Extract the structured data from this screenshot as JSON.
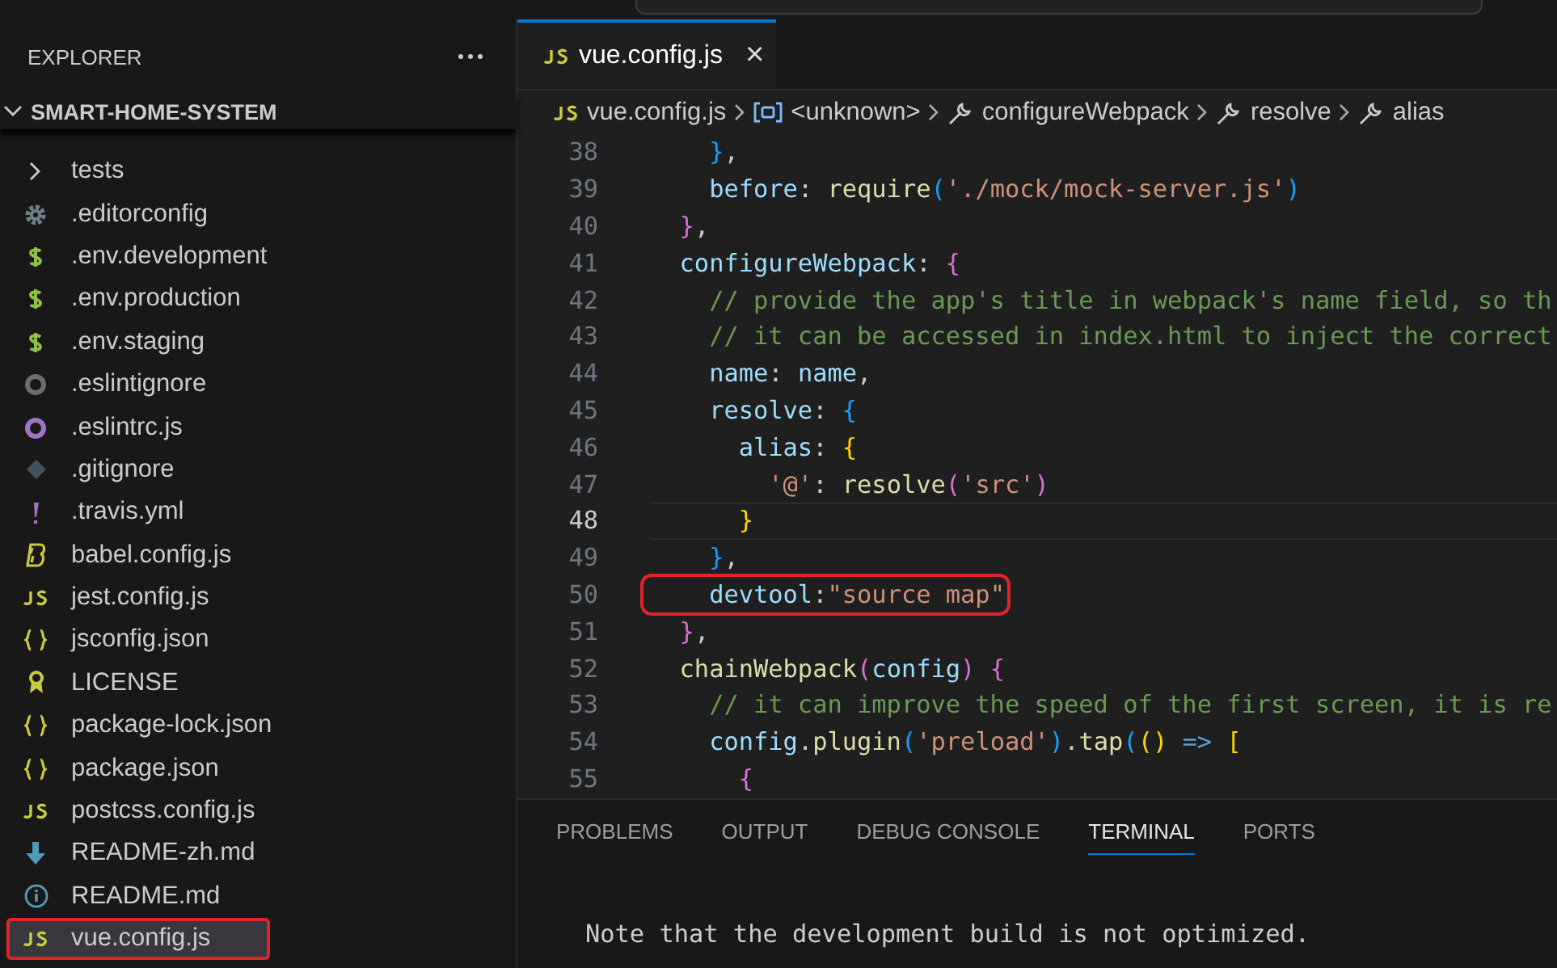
{
  "sidebar": {
    "title": "EXPLORER",
    "project": "SMART-HOME-SYSTEM",
    "items": [
      {
        "label": "tests",
        "kind": "folder",
        "selected": false,
        "highlighted": false
      },
      {
        "label": ".editorconfig",
        "kind": "gear",
        "selected": false,
        "highlighted": false
      },
      {
        "label": ".env.development",
        "kind": "dollar",
        "selected": false,
        "highlighted": false
      },
      {
        "label": ".env.production",
        "kind": "dollar",
        "selected": false,
        "highlighted": false
      },
      {
        "label": ".env.staging",
        "kind": "dollar",
        "selected": false,
        "highlighted": false
      },
      {
        "label": ".eslintignore",
        "kind": "ring-grey",
        "selected": false,
        "highlighted": false
      },
      {
        "label": ".eslintrc.js",
        "kind": "ring-purple",
        "selected": false,
        "highlighted": false
      },
      {
        "label": ".gitignore",
        "kind": "diamond",
        "selected": false,
        "highlighted": false
      },
      {
        "label": ".travis.yml",
        "kind": "exclaim",
        "selected": false,
        "highlighted": false
      },
      {
        "label": "babel.config.js",
        "kind": "b",
        "selected": false,
        "highlighted": false
      },
      {
        "label": "jest.config.js",
        "kind": "js",
        "selected": false,
        "highlighted": false
      },
      {
        "label": "jsconfig.json",
        "kind": "braces",
        "selected": false,
        "highlighted": false
      },
      {
        "label": "LICENSE",
        "kind": "license",
        "selected": false,
        "highlighted": false
      },
      {
        "label": "package-lock.json",
        "kind": "braces",
        "selected": false,
        "highlighted": false
      },
      {
        "label": "package.json",
        "kind": "braces",
        "selected": false,
        "highlighted": false
      },
      {
        "label": "postcss.config.js",
        "kind": "js",
        "selected": false,
        "highlighted": false
      },
      {
        "label": "README-zh.md",
        "kind": "down",
        "selected": false,
        "highlighted": false
      },
      {
        "label": "README.md",
        "kind": "info",
        "selected": false,
        "highlighted": false
      },
      {
        "label": "vue.config.js",
        "kind": "js",
        "selected": true,
        "highlighted": true
      }
    ]
  },
  "tab": {
    "label": "vue.config.js",
    "close": "×"
  },
  "breadcrumbs": [
    {
      "label": "vue.config.js",
      "kind": "js"
    },
    {
      "label": "<unknown>",
      "kind": "variable"
    },
    {
      "label": "configureWebpack",
      "kind": "wrench"
    },
    {
      "label": "resolve",
      "kind": "wrench"
    },
    {
      "label": "alias",
      "kind": "wrench"
    }
  ],
  "code": [
    {
      "number": "38",
      "current": false,
      "highlighted": false,
      "tokens": [
        {
          "text": "    }",
          "kind": "b3"
        },
        {
          "text": ",",
          "kind": "plain"
        }
      ]
    },
    {
      "number": "39",
      "current": false,
      "highlighted": false,
      "tokens": [
        {
          "text": "    before",
          "kind": "prop"
        },
        {
          "text": ": ",
          "kind": "plain"
        },
        {
          "text": "require",
          "kind": "func"
        },
        {
          "text": "(",
          "kind": "b3"
        },
        {
          "text": "'./mock/mock-server.js'",
          "kind": "str"
        },
        {
          "text": ")",
          "kind": "b3"
        }
      ]
    },
    {
      "number": "40",
      "current": false,
      "highlighted": false,
      "tokens": [
        {
          "text": "  }",
          "kind": "b2"
        },
        {
          "text": ",",
          "kind": "plain"
        }
      ]
    },
    {
      "number": "41",
      "current": false,
      "highlighted": false,
      "tokens": [
        {
          "text": "  configureWebpack",
          "kind": "prop"
        },
        {
          "text": ": ",
          "kind": "plain"
        },
        {
          "text": "{",
          "kind": "b2"
        }
      ]
    },
    {
      "number": "42",
      "current": false,
      "highlighted": false,
      "tokens": [
        {
          "text": "    // provide the app's title in webpack's name field, so th",
          "kind": "comment"
        }
      ]
    },
    {
      "number": "43",
      "current": false,
      "highlighted": false,
      "tokens": [
        {
          "text": "    // it can be accessed in index.html to inject the correct",
          "kind": "comment"
        }
      ]
    },
    {
      "number": "44",
      "current": false,
      "highlighted": false,
      "tokens": [
        {
          "text": "    name",
          "kind": "prop"
        },
        {
          "text": ": ",
          "kind": "plain"
        },
        {
          "text": "name",
          "kind": "prop"
        },
        {
          "text": ",",
          "kind": "plain"
        }
      ]
    },
    {
      "number": "45",
      "current": false,
      "highlighted": false,
      "tokens": [
        {
          "text": "    resolve",
          "kind": "prop"
        },
        {
          "text": ": ",
          "kind": "plain"
        },
        {
          "text": "{",
          "kind": "b3"
        }
      ]
    },
    {
      "number": "46",
      "current": false,
      "highlighted": false,
      "tokens": [
        {
          "text": "      alias",
          "kind": "prop"
        },
        {
          "text": ": ",
          "kind": "plain"
        },
        {
          "text": "{",
          "kind": "b1"
        }
      ]
    },
    {
      "number": "47",
      "current": false,
      "highlighted": false,
      "tokens": [
        {
          "text": "        '@'",
          "kind": "str"
        },
        {
          "text": ": ",
          "kind": "plain"
        },
        {
          "text": "resolve",
          "kind": "func"
        },
        {
          "text": "(",
          "kind": "b2"
        },
        {
          "text": "'src'",
          "kind": "str"
        },
        {
          "text": ")",
          "kind": "b2"
        }
      ]
    },
    {
      "number": "48",
      "current": true,
      "highlighted": false,
      "tokens": [
        {
          "text": "      }",
          "kind": "b1"
        }
      ]
    },
    {
      "number": "49",
      "current": false,
      "highlighted": false,
      "tokens": [
        {
          "text": "    }",
          "kind": "b3"
        },
        {
          "text": ",",
          "kind": "plain"
        }
      ]
    },
    {
      "number": "50",
      "current": false,
      "highlighted": true,
      "tokens": [
        {
          "text": "    devtool",
          "kind": "prop"
        },
        {
          "text": ":",
          "kind": "plain"
        },
        {
          "text": "\"source map\"",
          "kind": "str"
        }
      ]
    },
    {
      "number": "51",
      "current": false,
      "highlighted": false,
      "tokens": [
        {
          "text": "  }",
          "kind": "b2"
        },
        {
          "text": ",",
          "kind": "plain"
        }
      ]
    },
    {
      "number": "52",
      "current": false,
      "highlighted": false,
      "tokens": [
        {
          "text": "  chainWebpack",
          "kind": "func"
        },
        {
          "text": "(",
          "kind": "b2"
        },
        {
          "text": "config",
          "kind": "prop"
        },
        {
          "text": ")",
          "kind": "b2"
        },
        {
          "text": " {",
          "kind": "b2"
        }
      ]
    },
    {
      "number": "53",
      "current": false,
      "highlighted": false,
      "tokens": [
        {
          "text": "    // it can improve the speed of the first screen, it is re",
          "kind": "comment"
        }
      ]
    },
    {
      "number": "54",
      "current": false,
      "highlighted": false,
      "tokens": [
        {
          "text": "    config",
          "kind": "prop"
        },
        {
          "text": ".",
          "kind": "plain"
        },
        {
          "text": "plugin",
          "kind": "func"
        },
        {
          "text": "(",
          "kind": "b3"
        },
        {
          "text": "'preload'",
          "kind": "str"
        },
        {
          "text": ")",
          "kind": "b3"
        },
        {
          "text": ".",
          "kind": "plain"
        },
        {
          "text": "tap",
          "kind": "func"
        },
        {
          "text": "(",
          "kind": "b3"
        },
        {
          "text": "()",
          "kind": "b1"
        },
        {
          "text": " => ",
          "kind": "keyword"
        },
        {
          "text": "[",
          "kind": "b1"
        }
      ]
    },
    {
      "number": "55",
      "current": false,
      "highlighted": false,
      "tokens": [
        {
          "text": "      {",
          "kind": "b2"
        }
      ]
    }
  ],
  "panel": {
    "tabs": [
      {
        "label": "PROBLEMS",
        "selected": false
      },
      {
        "label": "OUTPUT",
        "selected": false
      },
      {
        "label": "DEBUG CONSOLE",
        "selected": false
      },
      {
        "label": "TERMINAL",
        "selected": true
      },
      {
        "label": "PORTS",
        "selected": false
      }
    ],
    "terminal": [
      "Note that the development build is not optimized."
    ]
  }
}
